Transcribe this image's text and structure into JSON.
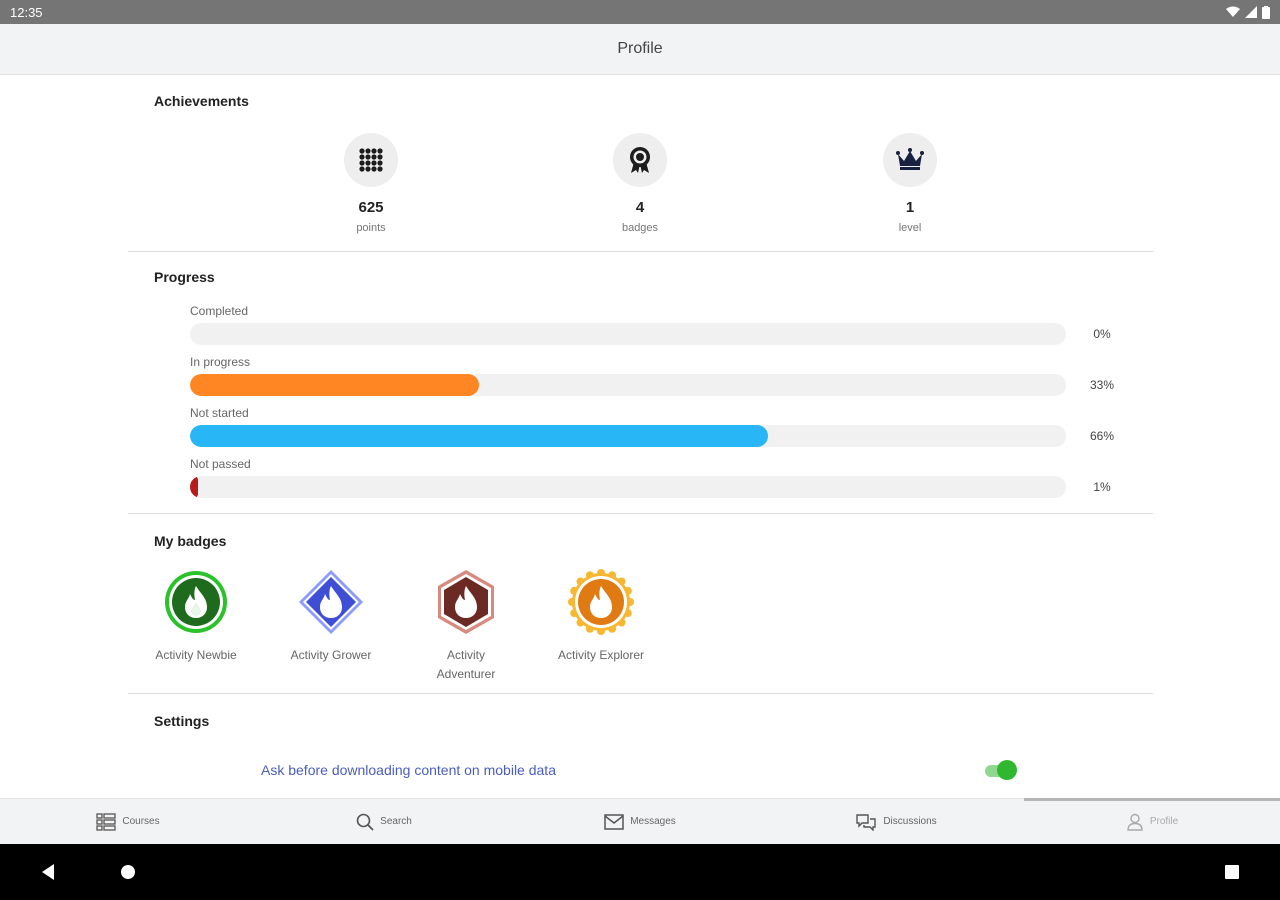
{
  "status_bar": {
    "time": "12:35"
  },
  "app_bar": {
    "title": "Profile"
  },
  "achievements": {
    "title": "Achievements",
    "items": [
      {
        "icon": "grid-dots-icon",
        "value": "625",
        "label": "points"
      },
      {
        "icon": "medal-icon",
        "value": "4",
        "label": "badges"
      },
      {
        "icon": "crown-icon",
        "value": "1",
        "label": "level"
      }
    ]
  },
  "progress": {
    "title": "Progress",
    "rows": [
      {
        "label": "Completed",
        "percent_text": "0%",
        "value": 0,
        "color": "#f1f1f1"
      },
      {
        "label": "In progress",
        "percent_text": "33%",
        "value": 33,
        "color": "#ff8622"
      },
      {
        "label": "Not started",
        "percent_text": "66%",
        "value": 66,
        "color": "#29b6f6"
      },
      {
        "label": "Not passed",
        "percent_text": "1%",
        "value": 1,
        "color": "#b71c1c"
      }
    ]
  },
  "badges": {
    "title": "My badges",
    "items": [
      {
        "label": "Activity Newbie",
        "icon": "flame-circle-badge-icon",
        "color": "#1e6b1e"
      },
      {
        "label": "Activity Grower",
        "icon": "flame-diamond-badge-icon",
        "color": "#3e4fd6"
      },
      {
        "label": "Activity Adventurer",
        "icon": "flame-hexagon-badge-icon",
        "color": "#6b2a24"
      },
      {
        "label": "Activity Explorer",
        "icon": "flame-star-badge-icon",
        "color": "#e07a12"
      }
    ]
  },
  "settings": {
    "title": "Settings",
    "download_prompt_label": "Ask before downloading content on mobile data",
    "download_prompt_enabled": true
  },
  "bottom_nav": {
    "items": [
      {
        "label": "Courses",
        "icon": "courses-grid-icon"
      },
      {
        "label": "Search",
        "icon": "search-icon"
      },
      {
        "label": "Messages",
        "icon": "envelope-icon"
      },
      {
        "label": "Discussions",
        "icon": "chat-bubbles-icon"
      },
      {
        "label": "Profile",
        "icon": "person-icon",
        "active": true
      }
    ]
  },
  "colors": {
    "accent_green": "#2fb82f",
    "link_blue": "#4a5dbf"
  }
}
